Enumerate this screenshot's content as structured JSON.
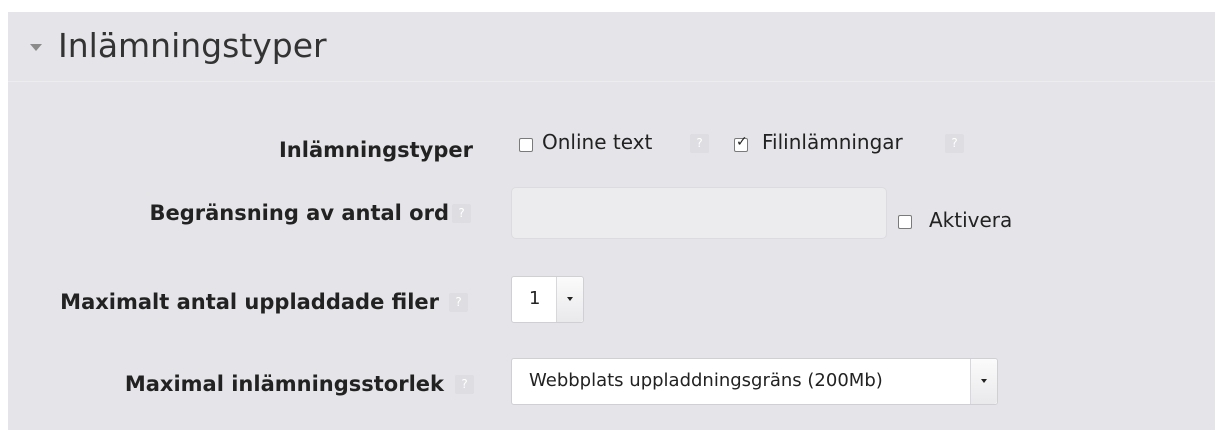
{
  "section": {
    "title": "Inlämningstyper"
  },
  "fields": {
    "submission_types": {
      "label": "Inlämningstyper",
      "options": [
        {
          "label": "Online text",
          "checked": false
        },
        {
          "label": "Filinlämningar",
          "checked": true
        }
      ]
    },
    "word_limit": {
      "label": "Begränsning av antal ord",
      "value": "",
      "enable_label": "Aktivera",
      "enabled": false
    },
    "max_files": {
      "label": "Maximalt antal uppladdade filer",
      "value": "1"
    },
    "max_size": {
      "label": "Maximal inlämningsstorlek",
      "value": "Webbplats uppladdningsgräns (200Mb)"
    }
  },
  "icons": {
    "help": "help-icon",
    "caret": "caret-down-icon",
    "dropdown": "chevron-down-icon"
  },
  "colors": {
    "panel_bg": "#e5e4e8",
    "text": "#222222"
  }
}
